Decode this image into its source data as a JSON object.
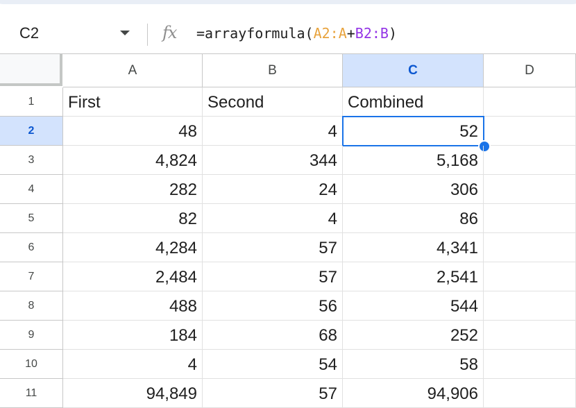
{
  "formula_bar": {
    "name_box": "C2",
    "fx_label": "fx",
    "formula_prefix": "=arrayformula(",
    "ref_a": "A2:A",
    "plus": "+",
    "ref_b": "B2:B",
    "formula_suffix": ")"
  },
  "columns": [
    "A",
    "B",
    "C",
    "D"
  ],
  "selected_column": "C",
  "rows": [
    {
      "num": "1",
      "a": "First",
      "b": "Second",
      "c": "Combined"
    },
    {
      "num": "2",
      "a": "48",
      "b": "4",
      "c": "52"
    },
    {
      "num": "3",
      "a": "4,824",
      "b": "344",
      "c": "5,168"
    },
    {
      "num": "4",
      "a": "282",
      "b": "24",
      "c": "306"
    },
    {
      "num": "5",
      "a": "82",
      "b": "4",
      "c": "86"
    },
    {
      "num": "6",
      "a": "4,284",
      "b": "57",
      "c": "4,341"
    },
    {
      "num": "7",
      "a": "2,484",
      "b": "57",
      "c": "2,541"
    },
    {
      "num": "8",
      "a": "488",
      "b": "56",
      "c": "544"
    },
    {
      "num": "9",
      "a": "184",
      "b": "68",
      "c": "252"
    },
    {
      "num": "10",
      "a": "4",
      "b": "54",
      "c": "58"
    },
    {
      "num": "11",
      "a": "94,849",
      "b": "57",
      "c": "94,906"
    }
  ],
  "selected_row": "2",
  "colors": {
    "accent": "#1a73e8",
    "selected_header": "#d3e3fd",
    "ref_a": "#e8a33d",
    "ref_b": "#9334e6"
  }
}
